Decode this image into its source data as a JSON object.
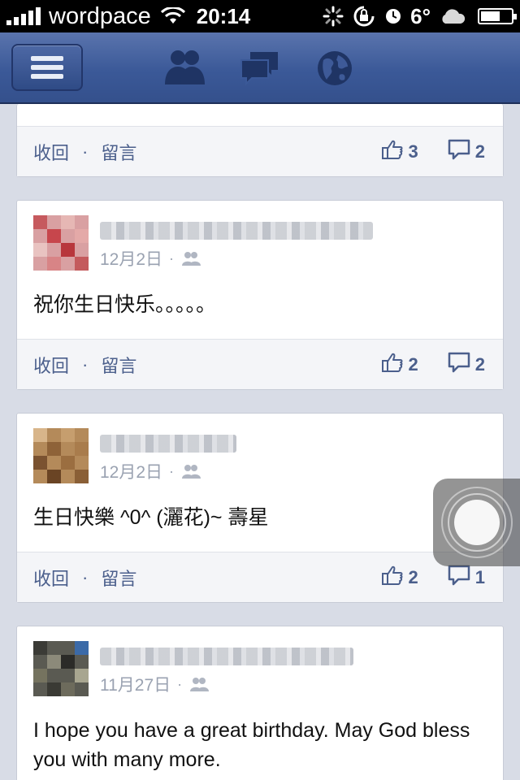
{
  "status_bar": {
    "carrier": "wordpace",
    "time": "20:14",
    "temperature": "6°",
    "battery_level": 0.65
  },
  "navbar": {
    "menu_icon": "hamburger-icon",
    "icons": [
      "friend-requests-icon",
      "messages-icon",
      "notifications-globe-icon"
    ]
  },
  "feed": {
    "top_card": {
      "hide_label": "收回",
      "separator": "·",
      "comment_label": "留言",
      "likes": "3",
      "comments": "2"
    },
    "posts": [
      {
        "date": "12月2日",
        "separator": "·",
        "text": "祝你生日快乐。。。。。",
        "hide_label": "收回",
        "comment_label": "留言",
        "likes": "2",
        "comments": "2"
      },
      {
        "date": "12月2日",
        "separator": "·",
        "text": "生日快樂 ^0^ (灑花)~ 壽星",
        "hide_label": "收回",
        "comment_label": "留言",
        "likes": "2",
        "comments": "1"
      },
      {
        "date": "11月27日",
        "separator": "·",
        "text": "I hope you have a great birthday. May God bless you with many more."
      }
    ]
  },
  "colors": {
    "nav_blue": "#3b5998",
    "link_blue": "#4b5f8c",
    "page_bg": "#d8dce6"
  }
}
